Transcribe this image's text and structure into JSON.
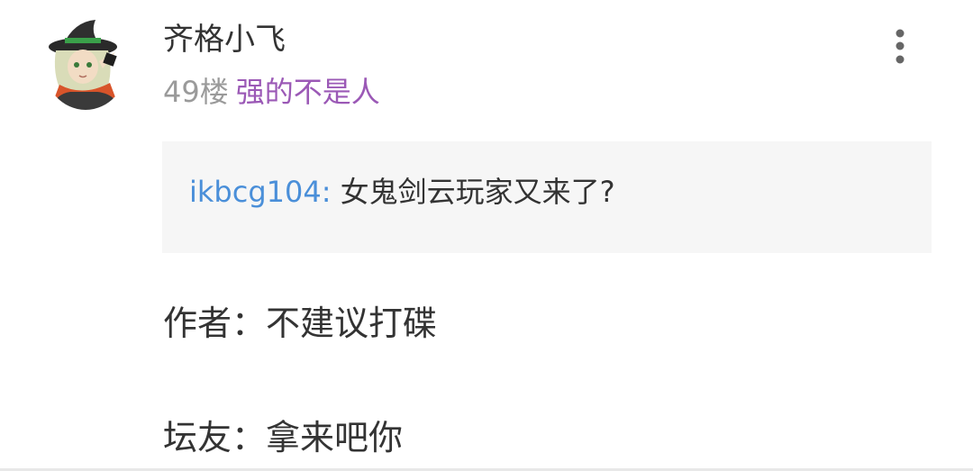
{
  "post": {
    "author": {
      "name": "齐格小飞",
      "floor": "49楼",
      "badge": "强的不是人"
    },
    "quote": {
      "user": "ikbcg104:",
      "text": "女鬼剑云玩家又来了?"
    },
    "lines": [
      "作者：不建议打碟",
      "坛友：拿来吧你"
    ],
    "menu_icon": "more-vertical-icon",
    "colors": {
      "username": "#333333",
      "floor": "#9a9a9a",
      "badge": "#9b59b6",
      "quote_user": "#4a8fd9",
      "quote_bg": "#f6f6f6"
    }
  }
}
